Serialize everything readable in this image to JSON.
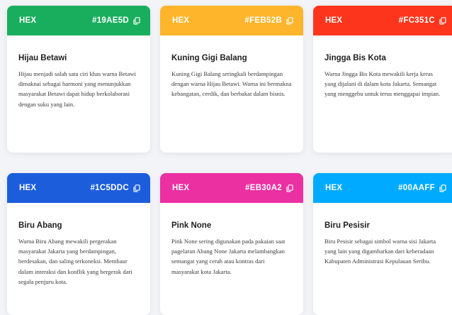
{
  "cards": [
    {
      "hex_label": "HEX",
      "hex": "#19AE5D",
      "color": "#19AE5D",
      "title": "Hijau Betawi",
      "description": "Hijau menjadi salah satu ciri khas warna Betawi dimaknai sebagai harmoni yang menunjukkan masyarakat Betawi dapat hidup berkolaborasi dengan suku yang lain."
    },
    {
      "hex_label": "HEX",
      "hex": "#FEB52B",
      "color": "#FEB52B",
      "title": "Kuning Gigi Balang",
      "description": "Kuning Gigi Balang seringkali berdampingan dengan warna Hijau Betawi. Warna ini bermakna kebangatan, cerdik, dan berbakat dalam bisnis."
    },
    {
      "hex_label": "HEX",
      "hex": "#FC351C",
      "color": "#FC351C",
      "title": "Jingga Bis Kota",
      "description": "Warna Jingga Bis Kota mewakili kerja keras yang dijalani di dalam kota Jakarta. Semangat yang menggebu untuk terus menggapai impian."
    },
    {
      "hex_label": "HEX",
      "hex": "#1C5DDC",
      "color": "#1C5DDC",
      "title": "Biru Abang",
      "description": "Warna Biru Abang mewakili pergerakan masyarakat Jakarta yang berdampingan, berdesakan, dan saling terkoneksi. Membaur dalam interaksi dan konflik yang bergerak dari segala penjuru kota."
    },
    {
      "hex_label": "HEX",
      "hex": "#EB30A2",
      "color": "#EB30A2",
      "title": "Pink None",
      "description": "Pink None sering digunakan pada pakaian saat pagelaran Abang None Jakarta melambangkan semangat yang cerah atau kontras dari masyarakat kota Jakarta."
    },
    {
      "hex_label": "HEX",
      "hex": "#00AAFF",
      "color": "#00AAFF",
      "title": "Biru Pesisir",
      "description": "Biru Pesisir sebagai simbol warna sisi Jakarta yang lain yang digambarkan dari keberadaan Kabupaten Administrasi Kepulauan Seribu."
    }
  ],
  "icons": {
    "copy": "copy-icon"
  }
}
